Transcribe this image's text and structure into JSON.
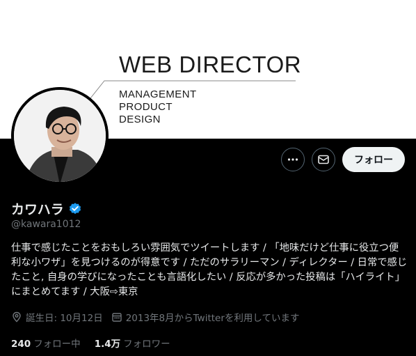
{
  "banner": {
    "title": "WEB DIRECTOR",
    "lines": [
      "MANAGEMENT",
      "PRODUCT",
      "DESIGN"
    ]
  },
  "actions": {
    "more_icon": "more-icon",
    "message_icon": "envelope-icon",
    "follow_label": "フォロー"
  },
  "profile": {
    "name": "カワハラ",
    "handle": "@kawara1012",
    "verified_color": "#1d9bf0",
    "bio": "仕事で感じたことをおもしろい雰囲気でツイートします / 「地味だけど仕事に役立つ便利な小ワザ」を見つけるのが得意です / ただのサラリーマン / ディレクター / 日常で感じたこと, 自身の学びになったことも言語化したい / 反応が多かった投稿は「ハイライト」にまとめてます / 大阪⇨東京",
    "birthday": "誕生日: 10月12日",
    "joined": "2013年8月からTwitterを利用しています"
  },
  "stats": {
    "following_count": "240",
    "following_label": "フォロー中",
    "followers_count": "1.4万",
    "followers_label": "フォロワー"
  }
}
